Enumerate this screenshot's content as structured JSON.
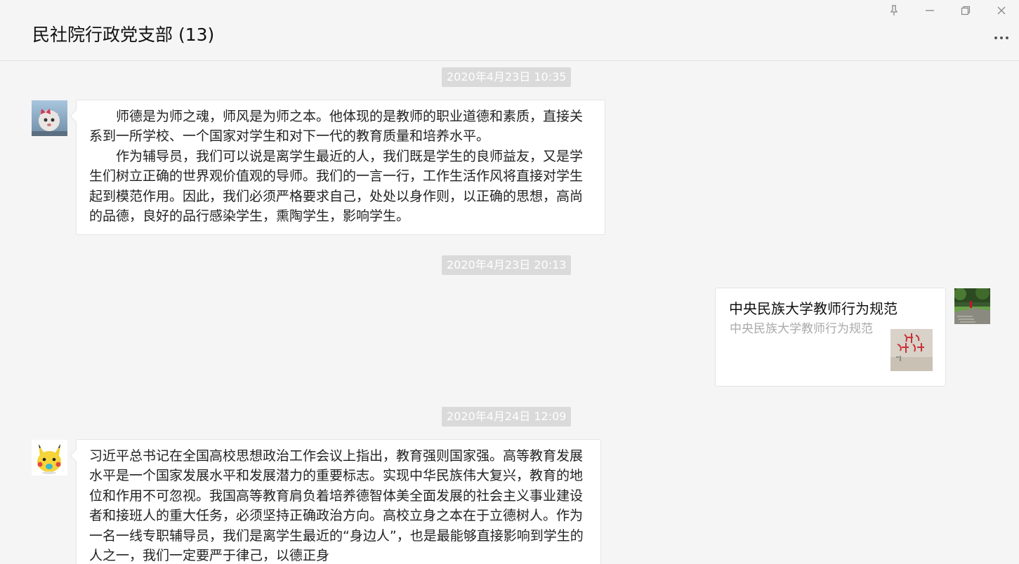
{
  "window": {
    "title": "民社院行政党支部 (13)",
    "controls": {
      "pin_icon": "pin-icon",
      "minimize_icon": "minimize-icon",
      "restore_icon": "restore-icon",
      "close_icon": "close-icon"
    },
    "more_icon": "more-icon"
  },
  "messages": [
    {
      "timestamp": "2020年4月23日 10:35",
      "side": "left",
      "avatar": "cat-avatar",
      "paragraphs": [
        "师德是为师之魂，师风是为师之本。他体现的是教师的职业道德和素质，直接关系到一所学校、一个国家对学生和对下一代的教育质量和培养水平。",
        "作为辅导员，我们可以说是离学生最近的人，我们既是学生的良师益友，又是学生们树立正确的世界观价值观的导师。我们的一言一行，工作生活作风将直接对学生起到模范作用。因此，我们必须严格要求自己，处处以身作则，以正确的思想，高尚的品德，良好的品行感染学生，熏陶学生，影响学生。"
      ]
    },
    {
      "timestamp": "2020年4月23日 20:13",
      "side": "right",
      "avatar": "park-avatar",
      "card": {
        "title": "中央民族大学教师行为规范",
        "description": "中央民族大学教师行为规范",
        "thumbnail": "calligraphy-thumbnail"
      }
    },
    {
      "timestamp": "2020年4月24日 12:09",
      "side": "left",
      "avatar": "pikachu-avatar",
      "text": "习近平总书记在全国高校思想政治工作会议上指出，教育强则国家强。高等教育发展水平是一个国家发展水平和发展潜力的重要标志。实现中华民族伟大复兴，教育的地位和作用不可忽视。我国高等教育肩负着培养德智体美全面发展的社会主义事业建设者和接班人的重大任务，必须坚持正确政治方向。高校立身之本在于立德树人。作为一名一线专职辅导员，我们是离学生最近的“身边人”，也是最能够直接影响到学生的人之一，我们一定要严于律己，以德正身"
    }
  ],
  "colors": {
    "background": "#f5f5f5",
    "bubble": "#ffffff",
    "timestamp_bg": "#dadada"
  }
}
